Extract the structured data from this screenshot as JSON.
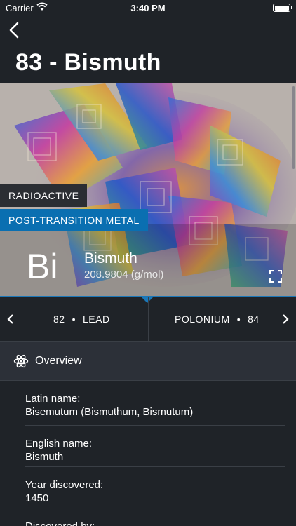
{
  "status_bar": {
    "carrier": "Carrier",
    "time": "3:40 PM"
  },
  "header": {
    "title": "83 - Bismuth"
  },
  "hero": {
    "tags": {
      "radioactive": "RADIOACTIVE",
      "category": "POST-TRANSITION METAL"
    },
    "symbol": "Bi",
    "name": "Bismuth",
    "weight": "208.9804 (g/mol)"
  },
  "navigation": {
    "prev": {
      "number": "82",
      "name": "LEAD"
    },
    "next": {
      "name": "POLONIUM",
      "number": "84"
    },
    "separator": "•"
  },
  "section": {
    "title": "Overview"
  },
  "info_rows": [
    {
      "label": "Latin name:",
      "value": "Bisemutum (Bismuthum, Bismutum)"
    },
    {
      "label": "English name:",
      "value": "Bismuth"
    },
    {
      "label": "Year discovered:",
      "value": "1450"
    },
    {
      "label": "Discovered by:",
      "value": ""
    }
  ],
  "colors": {
    "accent": "#1a77b8",
    "category_tag": "#0a6fb1",
    "background": "#1f2328",
    "section_bg": "#2c3038"
  }
}
